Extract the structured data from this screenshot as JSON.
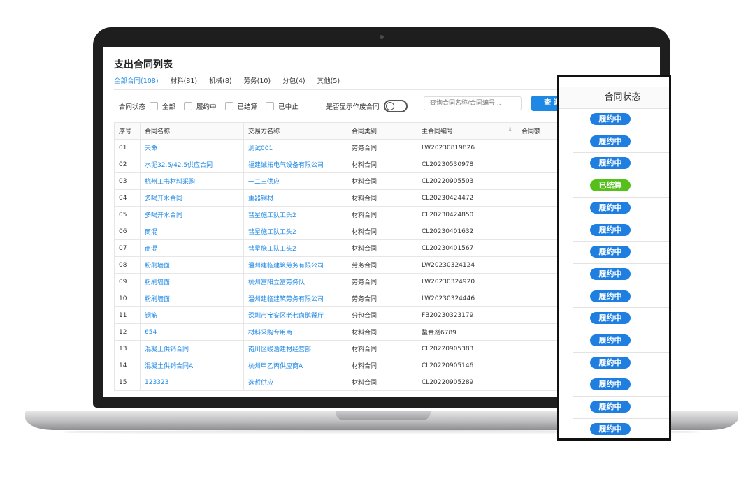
{
  "page": {
    "title": "支出合同列表",
    "tabs": [
      "全部合同(108)",
      "材料(81)",
      "机械(8)",
      "劳务(10)",
      "分包(4)",
      "其他(5)"
    ],
    "filter_label": "合同状态",
    "status_options": [
      "全部",
      "履约中",
      "已结算",
      "已中止"
    ],
    "switch_label": "是否显示作废合同",
    "search_placeholder": "查询合同名称/合同编号...",
    "query_button": "查 询",
    "columns": [
      "序号",
      "合同名称",
      "交易方名称",
      "合同类别",
      "主合同编号",
      "合同额"
    ],
    "rows": [
      [
        "01",
        "天命",
        "测试001",
        "劳务合同",
        "LW20230819826"
      ],
      [
        "02",
        "水泥32.5/42.5供应合同",
        "福建诚拓电气设备有限公司",
        "材料合同",
        "CL20230530978"
      ],
      [
        "03",
        "杭州工书材料采购",
        "一二三供应",
        "材料合同",
        "CL20220905503"
      ],
      [
        "04",
        "多喝开水合同",
        "重器钢材",
        "材料合同",
        "CL20230424472"
      ],
      [
        "05",
        "多喝开水合同",
        "彗星施工队工头2",
        "材料合同",
        "CL20230424850"
      ],
      [
        "06",
        "商混",
        "彗星施工队工头2",
        "材料合同",
        "CL20230401632"
      ],
      [
        "07",
        "商混",
        "彗星施工队工头2",
        "材料合同",
        "CL20230401567"
      ],
      [
        "08",
        "粉刷墙面",
        "温州建临建筑劳务有限公司",
        "劳务合同",
        "LW20230324124"
      ],
      [
        "09",
        "粉刷墙面",
        "杭州富阳立富劳务队",
        "劳务合同",
        "LW20230324920"
      ],
      [
        "10",
        "粉刷墙面",
        "温州建临建筑劳务有限公司",
        "劳务合同",
        "LW20230324446"
      ],
      [
        "11",
        "钢筋",
        "深圳市宝安区老七卤鹅餐厅",
        "分包合同",
        "FB20230323179"
      ],
      [
        "12",
        "654",
        "材料采购专用商",
        "材料合同",
        "螯合剂6789"
      ],
      [
        "13",
        "混凝土供销合同",
        "南川区峻浩建材经营部",
        "材料合同",
        "CL20220905383"
      ],
      [
        "14",
        "混凝土供销合同A",
        "杭州甲乙丙供应商A",
        "材料合同",
        "CL20220905146"
      ],
      [
        "15",
        "123323",
        "选哲供应",
        "材料合同",
        "CL20220905289"
      ]
    ]
  },
  "callout": {
    "header": "合同状态",
    "statuses": [
      "履约中",
      "履约中",
      "履约中",
      "已结算",
      "履约中",
      "履约中",
      "履约中",
      "履约中",
      "履约中",
      "履约中",
      "履约中",
      "履约中",
      "履约中",
      "履约中",
      "履约中"
    ]
  },
  "colors": {
    "accent": "#1e88e5",
    "pill_blue": "#1e7fe0",
    "pill_green": "#56c01a"
  }
}
